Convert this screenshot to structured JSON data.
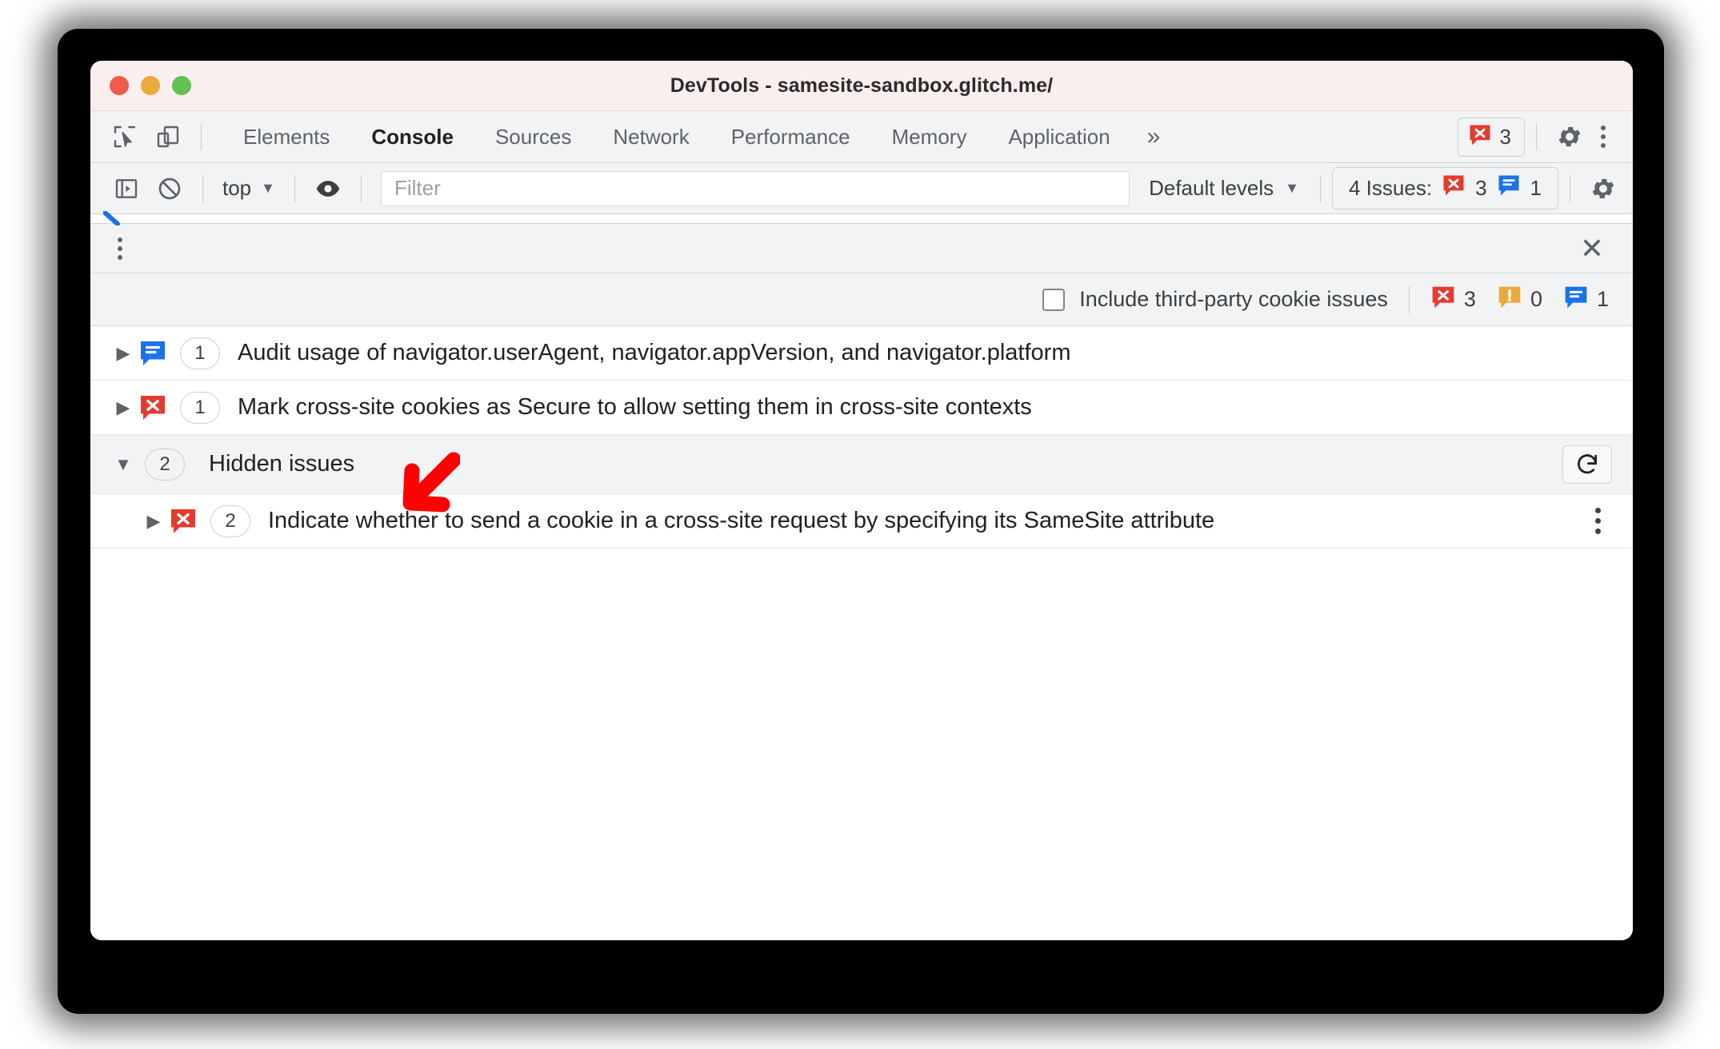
{
  "window": {
    "title": "DevTools - samesite-sandbox.glitch.me/",
    "traffic_lights": [
      "close",
      "minimize",
      "maximize"
    ]
  },
  "tabbar": {
    "inspect_icon": "inspect-cursor-icon",
    "device_icon": "device-toolbar-icon",
    "tabs": [
      {
        "label": "Elements",
        "active": false
      },
      {
        "label": "Console",
        "active": true
      },
      {
        "label": "Sources",
        "active": false
      },
      {
        "label": "Network",
        "active": false
      },
      {
        "label": "Performance",
        "active": false
      },
      {
        "label": "Memory",
        "active": false
      },
      {
        "label": "Application",
        "active": false
      }
    ],
    "more_tabs": "»",
    "error_chip": {
      "icon": "error-icon",
      "count": "3"
    },
    "settings_icon": "gear-icon",
    "more_options_icon": "kebab-menu-icon"
  },
  "console_toolbar": {
    "sidebar_toggle_icon": "console-sidebar-icon",
    "clear_icon": "clear-console-icon",
    "context": "top",
    "context_caret": "▼",
    "eye_icon": "live-expression-eye-icon",
    "filter_placeholder": "Filter",
    "filter_value": "",
    "levels_label": "Default levels",
    "levels_caret": "▼",
    "issues_chip_label": "4 Issues:",
    "issues_error_count": "3",
    "issues_info_count": "1",
    "settings_icon": "gear-icon"
  },
  "drawer": {
    "menu_icon": "kebab-menu-icon",
    "close_icon": "close-icon"
  },
  "issues_toolbar": {
    "checkbox_checked": false,
    "checkbox_label": "Include third-party cookie issues",
    "error_count": "3",
    "warning_count": "0",
    "info_count": "1"
  },
  "issues": [
    {
      "expander": "▶",
      "expanded": false,
      "severity": "info",
      "count": "1",
      "title": "Audit usage of navigator.userAgent, navigator.appVersion, and navigator.platform",
      "nested": false,
      "group": false
    },
    {
      "expander": "▶",
      "expanded": false,
      "severity": "error",
      "count": "1",
      "title": "Mark cross-site cookies as Secure to allow setting them in cross-site contexts",
      "nested": false,
      "group": false
    },
    {
      "expander": "▼",
      "expanded": true,
      "severity": "none",
      "count": "2",
      "title": "Hidden issues",
      "nested": false,
      "group": true,
      "action_icon": "refresh-icon"
    },
    {
      "expander": "▶",
      "expanded": false,
      "severity": "error",
      "count": "2",
      "title": "Indicate whether to send a cookie in a cross-site request by specifying its SameSite attribute",
      "nested": true,
      "group": false,
      "row_menu_icon": "kebab-menu-icon"
    }
  ],
  "annotation": {
    "arrow": "red-arrow-pointing-to-hidden-issues",
    "color": "#ff0000"
  },
  "colors": {
    "error": "#e33b2e",
    "warning": "#eca73d",
    "info": "#1a73e8",
    "titlebar": "#faeeee",
    "toolbar": "#f1f3f4",
    "text": "#202124",
    "muted": "#5f6368"
  }
}
